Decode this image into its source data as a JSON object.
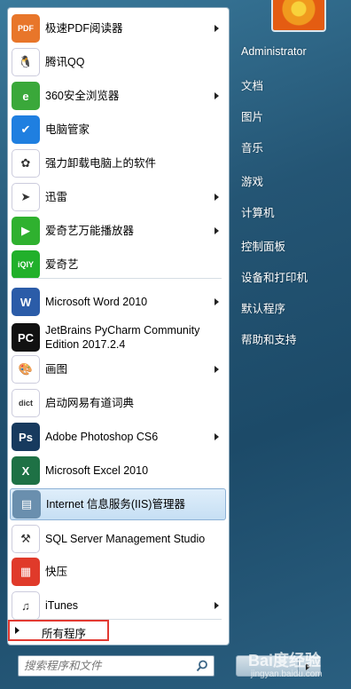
{
  "programs": [
    {
      "label": "极速PDF阅读器",
      "icon": "pdf-reader-icon",
      "color": "#e8762a",
      "glyph": "PDF",
      "arrow": true
    },
    {
      "label": "腾讯QQ",
      "icon": "qq-penguin-icon",
      "color": "#ffffff",
      "glyph": "🐧",
      "arrow": false
    },
    {
      "label": "360安全浏览器",
      "icon": "360-browser-icon",
      "color": "#3aa83a",
      "glyph": "e",
      "arrow": true
    },
    {
      "label": "电脑管家",
      "icon": "pc-manager-shield-icon",
      "color": "#1f7fe0",
      "glyph": "✔",
      "arrow": false
    },
    {
      "label": "强力卸载电脑上的软件",
      "icon": "uninstaller-icon",
      "color": "#ffffff",
      "glyph": "✿",
      "arrow": false
    },
    {
      "label": "迅雷",
      "icon": "xunlei-bird-icon",
      "color": "#ffffff",
      "glyph": "➤",
      "arrow": true
    },
    {
      "label": "爱奇艺万能播放器",
      "icon": "iqiyi-player-icon",
      "color": "#2fb12f",
      "glyph": "▶",
      "arrow": true
    },
    {
      "label": "爱奇艺",
      "icon": "iqiyi-icon",
      "color": "#21b02b",
      "glyph": "iQIY",
      "arrow": false
    },
    {
      "label": "Microsoft Word 2010",
      "icon": "word-icon",
      "color": "#2b5ca8",
      "glyph": "W",
      "arrow": true
    },
    {
      "label": "JetBrains PyCharm Community Edition 2017.2.4",
      "icon": "pycharm-icon",
      "color": "#111111",
      "glyph": "PC",
      "arrow": false
    },
    {
      "label": "画图",
      "icon": "paint-palette-icon",
      "color": "#ffffff",
      "glyph": "🎨",
      "arrow": true
    },
    {
      "label": "启动网易有道词典",
      "icon": "youdao-dict-icon",
      "color": "#ffffff",
      "glyph": "dict",
      "arrow": false
    },
    {
      "label": "Adobe Photoshop CS6",
      "icon": "photoshop-icon",
      "color": "#173a5e",
      "glyph": "Ps",
      "arrow": true
    },
    {
      "label": "Microsoft Excel 2010",
      "icon": "excel-icon",
      "color": "#1e7145",
      "glyph": "X",
      "arrow": false
    },
    {
      "label": "Internet 信息服务(IIS)管理器",
      "icon": "iis-manager-icon",
      "color": "#6a8fae",
      "glyph": "▤",
      "arrow": false
    },
    {
      "label": "SQL Server Management Studio",
      "icon": "sql-server-tools-icon",
      "color": "#ffffff",
      "glyph": "⚒",
      "arrow": false
    },
    {
      "label": "快压",
      "icon": "kuaiya-archive-icon",
      "color": "#e03a2a",
      "glyph": "▦",
      "arrow": false
    },
    {
      "label": "iTunes",
      "icon": "itunes-icon",
      "color": "#ffffff",
      "glyph": "♫",
      "arrow": true
    }
  ],
  "all_programs_label": "所有程序",
  "search": {
    "placeholder": "搜索程序和文件"
  },
  "right_panel": [
    {
      "label": "Administrator"
    },
    {
      "label": "文档"
    },
    {
      "label": "图片"
    },
    {
      "label": "音乐"
    },
    {
      "label": "游戏"
    },
    {
      "label": "计算机"
    },
    {
      "label": "控制面板"
    },
    {
      "label": "设备和打印机"
    },
    {
      "label": "默认程序"
    },
    {
      "label": "帮助和支持"
    }
  ],
  "watermark": {
    "text": "Bai度经验",
    "sub": "jingyan.baidu.com"
  }
}
